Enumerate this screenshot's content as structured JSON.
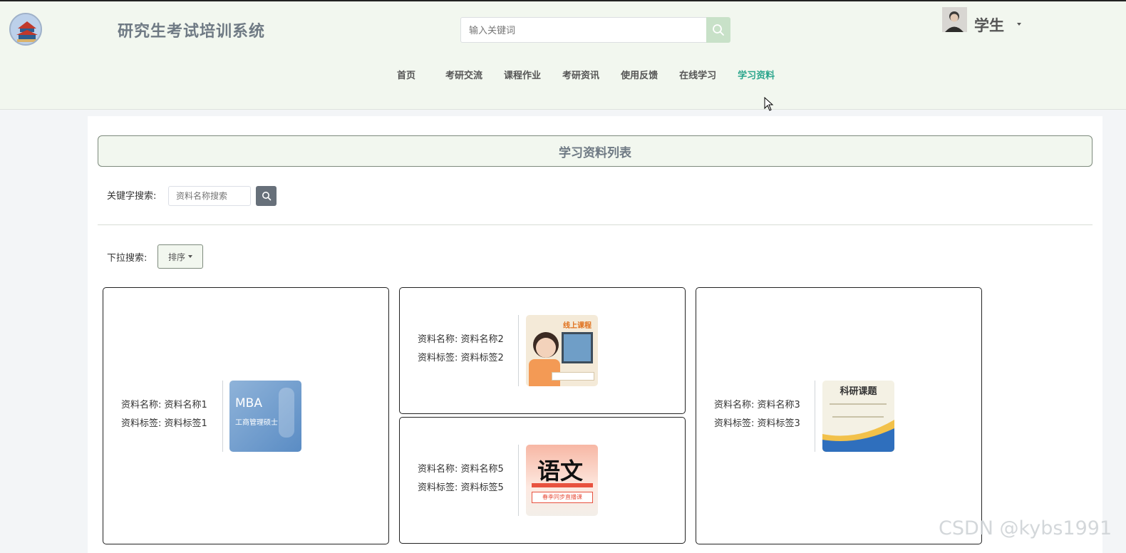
{
  "header": {
    "site_title": "研究生考试培训系统",
    "search_placeholder": "输入关键词",
    "user_name": "学生"
  },
  "nav": [
    {
      "label": "首页"
    },
    {
      "label": "考研交流"
    },
    {
      "label": "课程作业"
    },
    {
      "label": "考研资讯"
    },
    {
      "label": "使用反馈"
    },
    {
      "label": "在线学习"
    },
    {
      "label": "学习资料",
      "active": true
    }
  ],
  "page": {
    "list_title": "学习资料列表",
    "keyword_label": "关键字搜索:",
    "keyword_placeholder": "资料名称搜索",
    "dropdown_label": "下拉搜索:",
    "sort_label": "排序"
  },
  "cards": [
    {
      "name_line": "资料名称: 资料名称1",
      "tag_line": "资料标签: 资料标签1",
      "image_text": "MBA",
      "image_sub": "工商管理硕士"
    },
    {
      "name_line": "资料名称: 资料名称2",
      "tag_line": "资料标签: 资料标签2",
      "image_text": "线上课程"
    },
    {
      "name_line": "资料名称: 资料名称5",
      "tag_line": "资料标签: 资料标签5",
      "image_text": "语文",
      "image_sub": "春季同步直播课"
    },
    {
      "name_line": "资料名称: 资料名称3",
      "tag_line": "资料标签: 资料标签3",
      "image_text": "科研课题"
    }
  ],
  "watermark": "CSDN @kybs1991",
  "colors": {
    "header_bg": "#f2f7ef",
    "active_nav": "#2aa58c",
    "search_btn": "#c8e1c8"
  }
}
